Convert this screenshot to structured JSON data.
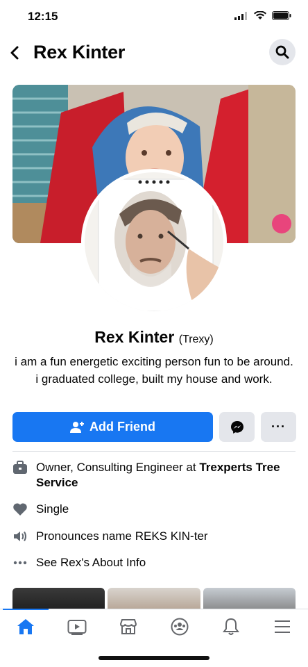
{
  "status_bar": {
    "time": "12:15"
  },
  "header": {
    "title": "Rex Kinter"
  },
  "profile": {
    "name": "Rex Kinter",
    "nickname": "(Trexy)",
    "bio": "i am a fun energetic exciting person fun to be around.  i graduated college, built my house and work."
  },
  "actions": {
    "add_friend_label": "Add Friend",
    "more_label": "···"
  },
  "info": {
    "work_prefix": "Owner, Consulting Engineer at ",
    "work_company": "Trexperts Tree Service",
    "relationship": "Single",
    "pronunciation": "Pronounces name REKS KIN-ter",
    "about_link": "See Rex's About Info"
  },
  "colors": {
    "accent": "#1877f2",
    "button_gray": "#e4e6eb"
  },
  "tabs": [
    "home-icon",
    "watch-icon",
    "marketplace-icon",
    "groups-icon",
    "notifications-icon",
    "menu-icon"
  ]
}
